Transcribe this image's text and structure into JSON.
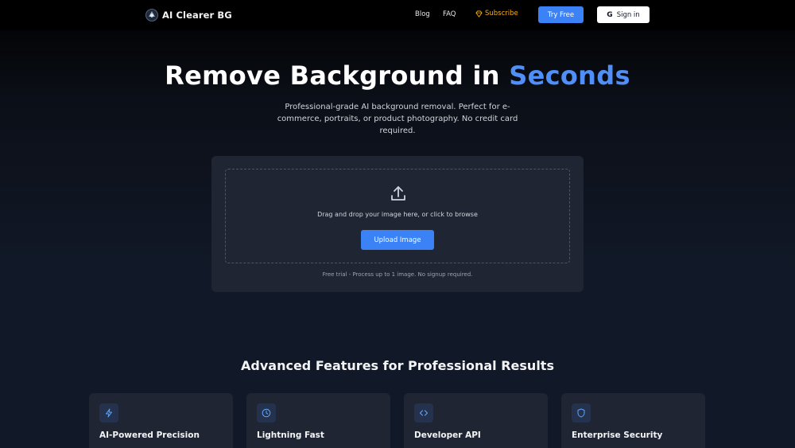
{
  "header": {
    "brand": "AI Clearer BG",
    "nav": {
      "blog": "Blog",
      "faq": "FAQ",
      "subscribe": "Subscribe"
    },
    "try_free": "Try Free",
    "sign_in": "Sign in",
    "google_glyph": "G"
  },
  "hero": {
    "title_main": "Remove Background in ",
    "title_accent": "Seconds",
    "subtitle": "Professional-grade AI background removal. Perfect for e-commerce, portraits, or product photography. No credit card required."
  },
  "upload": {
    "drop_text": "Drag and drop your image here, or click to browse",
    "button": "Upload Image",
    "trial_note": "Free trial - Process up to 1 image. No signup required."
  },
  "features": {
    "title": "Advanced Features for Professional Results",
    "items": [
      {
        "name": "AI-Powered Precision",
        "icon": "lightning-icon"
      },
      {
        "name": "Lightning Fast",
        "icon": "clock-icon"
      },
      {
        "name": "Developer API",
        "icon": "code-icon"
      },
      {
        "name": "Enterprise Security",
        "icon": "shield-icon"
      }
    ]
  },
  "colors": {
    "accent": "#3b82f6",
    "subscribe": "#f5b014",
    "card": "#1f2533"
  }
}
